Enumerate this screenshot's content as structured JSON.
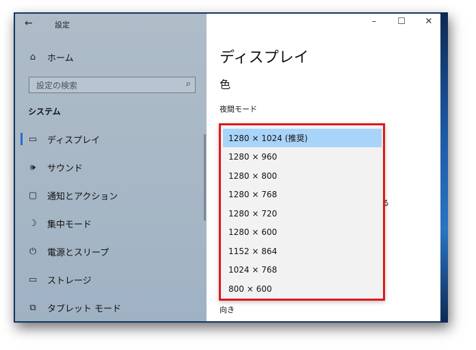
{
  "window": {
    "title": "設定",
    "controls": {
      "minimize": "–",
      "maximize": "☐",
      "close": "✕"
    }
  },
  "sidebar": {
    "home": {
      "icon": "home-icon",
      "glyph": "⌂",
      "label": "ホーム"
    },
    "search": {
      "placeholder": "設定の検索",
      "icon": "search-icon"
    },
    "section": "システム",
    "items": [
      {
        "icon": "monitor-icon",
        "glyph": "▭",
        "label": "ディスプレイ",
        "selected": true
      },
      {
        "icon": "speaker-icon",
        "glyph": "🕪",
        "label": "サウンド"
      },
      {
        "icon": "message-icon",
        "glyph": "▢",
        "label": "通知とアクション"
      },
      {
        "icon": "moon-icon",
        "glyph": "☽",
        "label": "集中モード"
      },
      {
        "icon": "power-icon",
        "glyph": "⏻",
        "label": "電源とスリープ"
      },
      {
        "icon": "storage-icon",
        "glyph": "▭",
        "label": "ストレージ"
      },
      {
        "icon": "tablet-icon",
        "glyph": "⧉",
        "label": "タブレット モード"
      }
    ],
    "accent": "#1f6fd1"
  },
  "main": {
    "title": "ディスプレイ",
    "color_heading": "色",
    "night_mode_label": "夜間モード",
    "orientation_label": "向き",
    "partial_text": "る"
  },
  "resolution_dropdown": {
    "highlight_color": "#e0161c",
    "selected_bg": "#a9d4f9",
    "options": [
      {
        "label": "1280 × 1024 (推奨)",
        "selected": true
      },
      {
        "label": "1280 × 960"
      },
      {
        "label": "1280 × 800"
      },
      {
        "label": "1280 × 768"
      },
      {
        "label": "1280 × 720"
      },
      {
        "label": "1280 × 600"
      },
      {
        "label": "1152 × 864"
      },
      {
        "label": "1024 × 768"
      },
      {
        "label": "800 × 600"
      }
    ]
  }
}
